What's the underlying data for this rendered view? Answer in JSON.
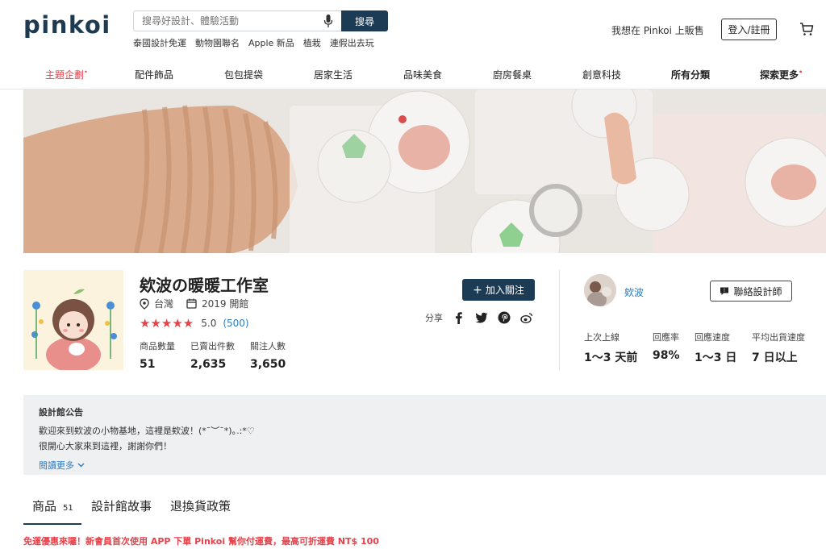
{
  "header": {
    "logo": "pinkoi",
    "search_placeholder": "搜尋好設計、體驗活動",
    "search_button": "搜尋",
    "hot_tags": [
      "泰國設計免運",
      "動物園聯名",
      "Apple 新品",
      "植栽",
      "連假出去玩"
    ],
    "sell_link": "我想在 Pinkoi 上販售",
    "login_button": "登入/註冊"
  },
  "nav": {
    "items": [
      "主題企劃",
      "配件飾品",
      "包包提袋",
      "居家生活",
      "品味美食",
      "廚房餐桌",
      "創意科技",
      "所有分類",
      "探索更多"
    ]
  },
  "shop": {
    "name": "欸波の暖暖工作室",
    "location": "台灣",
    "opened": "2019 開館",
    "stars": "★★★★★",
    "rating": "5.0",
    "rating_count": "(500)",
    "stats": [
      {
        "label": "商品數量",
        "value": "51"
      },
      {
        "label": "已賣出件數",
        "value": "2,635"
      },
      {
        "label": "關注人數",
        "value": "3,650"
      }
    ],
    "follow_button": "加入關注",
    "share_label": "分享"
  },
  "designer": {
    "name": "欸波",
    "contact_button": "聯絡設計師",
    "stats": [
      {
        "label": "上次上線",
        "value": "1～3 天前"
      },
      {
        "label": "回應率",
        "value": "98%"
      },
      {
        "label": "回應速度",
        "value": "1～3 日"
      },
      {
        "label": "平均出貨速度",
        "value": "7 日以上"
      }
    ]
  },
  "announcement": {
    "title": "設計館公告",
    "line1": "歡迎來到欸波の小物基地，這裡是欸波！(*¯︶¯*)｡.:*♡",
    "line2": "很開心大家來到這裡，謝謝你們！",
    "read_more": "閱讀更多"
  },
  "tabs": {
    "products_label": "商品",
    "products_count": "51",
    "story_label": "設計館故事",
    "policy_label": "退換貨政策"
  },
  "promo": "免運優惠來囉！新會員首次使用 APP 下單 Pinkoi 幫你付運費，最高可折運費 NT$ 100",
  "colors": {
    "brand_navy": "#1c3b55",
    "accent_red": "#e8414a",
    "link_blue": "#2b7cc1"
  }
}
